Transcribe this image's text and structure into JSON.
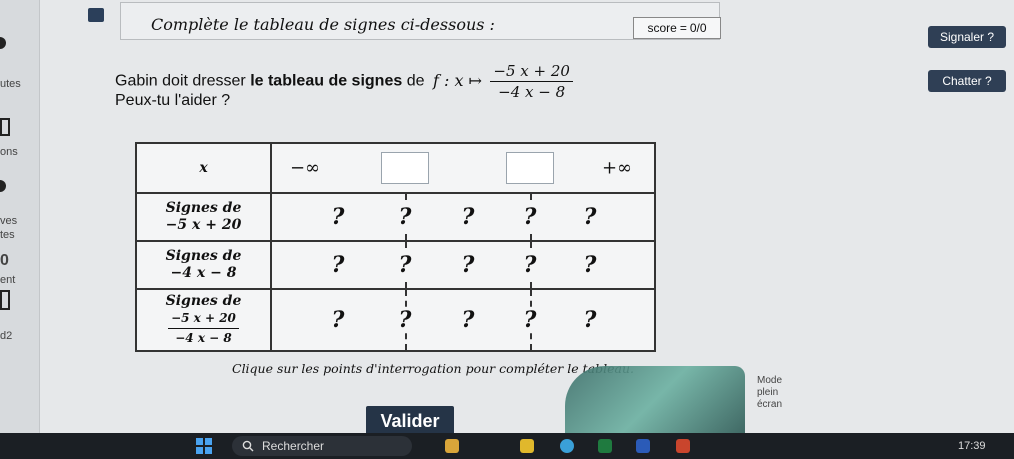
{
  "sidebar": {
    "items": [
      "utes",
      "ons",
      "ves",
      "tes",
      "0",
      "ent",
      "d2"
    ]
  },
  "header": {
    "instruction": "Complète le tableau de signes ci-dessous :",
    "score_label": "score",
    "score_eq": "=",
    "score_value": "0/0"
  },
  "side_buttons": {
    "report": "Signaler ?",
    "chat": "Chatter ?"
  },
  "question": {
    "text_before": "Gabin doit dresser",
    "bold": "le tableau de signes",
    "text_after": "de",
    "func_name": "f : x ↦",
    "numerator": "−5 x + 20",
    "denominator": "−4 x − 8",
    "help": "Peux-tu l'aider ?"
  },
  "table": {
    "x_label": "x",
    "minus_inf": "−∞",
    "plus_inf": "+∞",
    "rows": [
      {
        "label_line1": "Signes de",
        "label_line2": "−5 x + 20"
      },
      {
        "label_line1": "Signes de",
        "label_line2": "−4 x − 8"
      },
      {
        "label_line1": "Signes de",
        "frac_num": "−5 x + 20",
        "frac_den": "−4 x − 8"
      }
    ],
    "unknown": "?"
  },
  "hint": "Clique sur les points d'interrogation pour compléter le tableau.",
  "actions": {
    "validate": "Valider"
  },
  "mode": {
    "line1": "Mode",
    "line2": "plein",
    "line3": "écran"
  },
  "taskbar": {
    "search_placeholder": "Rechercher",
    "time": "17:39"
  },
  "colors": {
    "button_dark": "#253447",
    "background": "#e6e8ea"
  }
}
